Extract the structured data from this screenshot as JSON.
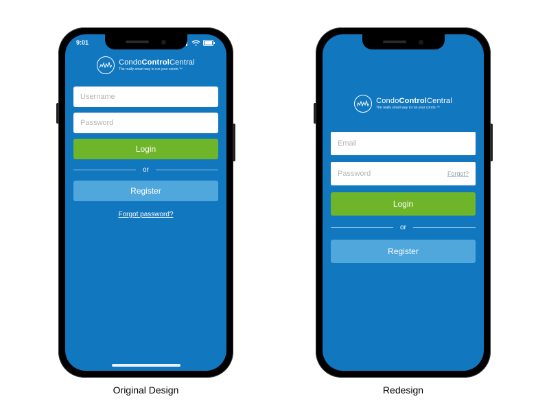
{
  "brand": {
    "name_html_parts": [
      "Condo",
      "Control",
      "Central"
    ],
    "tagline": "The really smart way to run your condo.™"
  },
  "colors": {
    "app_bg": "#1177bf",
    "login_btn": "#6fb52a",
    "register_btn": "#50a7dc",
    "placeholder": "#b4b4b4"
  },
  "statusbar": {
    "time": "9:01"
  },
  "original": {
    "caption": "Original Design",
    "username_placeholder": "Username",
    "password_placeholder": "Password",
    "login_label": "Login",
    "divider_label": "or",
    "register_label": "Register",
    "forgot_label": "Forgot password?"
  },
  "redesign": {
    "caption": "Redesign",
    "email_placeholder": "Email",
    "password_placeholder": "Password",
    "forgot_inline": "Forgot?",
    "login_label": "Login",
    "divider_label": "or",
    "register_label": "Register"
  }
}
